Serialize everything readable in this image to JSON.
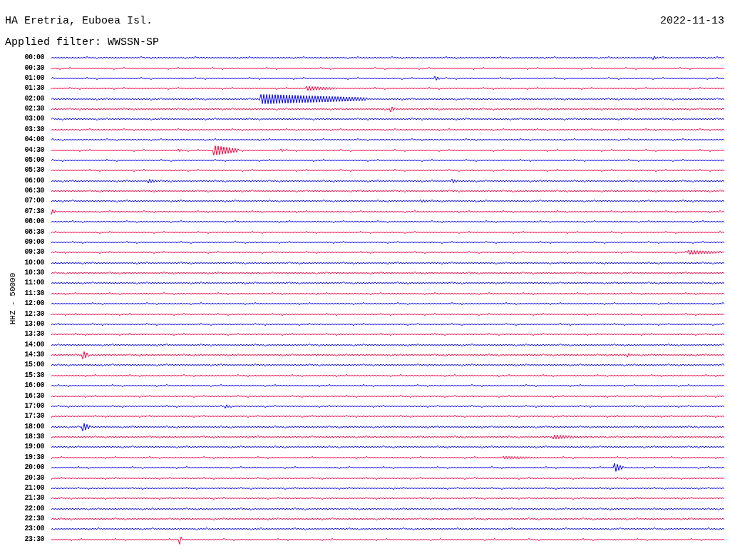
{
  "header": {
    "station": "HA Eretria, Euboea Isl.",
    "date": "2022-11-13",
    "filter": "Applied filter: WWSSN-SP"
  },
  "axis_label": "HHZ - 50000",
  "traces": [
    {
      "time": "00:00",
      "color": "#0000ff"
    },
    {
      "time": "00:30",
      "color": "#ff0040"
    },
    {
      "time": "01:00",
      "color": "#0000ff"
    },
    {
      "time": "01:30",
      "color": "#ff0040"
    },
    {
      "time": "02:00",
      "color": "#0000ff"
    },
    {
      "time": "02:30",
      "color": "#ff0040"
    },
    {
      "time": "03:00",
      "color": "#0000ff"
    },
    {
      "time": "03:30",
      "color": "#ff0040"
    },
    {
      "time": "04:00",
      "color": "#0000ff"
    },
    {
      "time": "04:30",
      "color": "#ff0040"
    },
    {
      "time": "05:00",
      "color": "#0000ff"
    },
    {
      "time": "05:30",
      "color": "#ff0040"
    },
    {
      "time": "06:00",
      "color": "#0000ff"
    },
    {
      "time": "06:30",
      "color": "#ff0040"
    },
    {
      "time": "07:00",
      "color": "#0000ff"
    },
    {
      "time": "07:30",
      "color": "#ff0040"
    },
    {
      "time": "08:00",
      "color": "#0000ff"
    },
    {
      "time": "08:30",
      "color": "#ff0040"
    },
    {
      "time": "09:00",
      "color": "#0000ff"
    },
    {
      "time": "09:30",
      "color": "#ff0040"
    },
    {
      "time": "10:00",
      "color": "#0000ff"
    },
    {
      "time": "10:30",
      "color": "#ff0040"
    },
    {
      "time": "11:00",
      "color": "#0000ff"
    },
    {
      "time": "11:30",
      "color": "#ff0040"
    },
    {
      "time": "12:00",
      "color": "#0000ff"
    },
    {
      "time": "12:30",
      "color": "#ff0040"
    },
    {
      "time": "13:00",
      "color": "#0000ff"
    },
    {
      "time": "13:30",
      "color": "#ff0040"
    },
    {
      "time": "14:00",
      "color": "#0000ff"
    },
    {
      "time": "14:30",
      "color": "#ff0040"
    },
    {
      "time": "15:00",
      "color": "#0000ff"
    },
    {
      "time": "15:30",
      "color": "#ff0040"
    },
    {
      "time": "16:00",
      "color": "#0000ff"
    },
    {
      "time": "16:30",
      "color": "#ff0040"
    },
    {
      "time": "17:00",
      "color": "#0000ff"
    },
    {
      "time": "17:30",
      "color": "#ff0040"
    },
    {
      "time": "18:00",
      "color": "#0000ff"
    },
    {
      "time": "18:30",
      "color": "#ff0040"
    },
    {
      "time": "19:00",
      "color": "#0000ff"
    },
    {
      "time": "19:30",
      "color": "#ff0040"
    },
    {
      "time": "20:00",
      "color": "#0000ff"
    },
    {
      "time": "20:30",
      "color": "#ff0040"
    },
    {
      "time": "21:00",
      "color": "#0000ff"
    },
    {
      "time": "21:30",
      "color": "#ff0040"
    },
    {
      "time": "22:00",
      "color": "#0000ff"
    },
    {
      "time": "22:30",
      "color": "#ff0040"
    },
    {
      "time": "23:00",
      "color": "#0000ff"
    },
    {
      "time": "23:30",
      "color": "#ff0040"
    }
  ]
}
